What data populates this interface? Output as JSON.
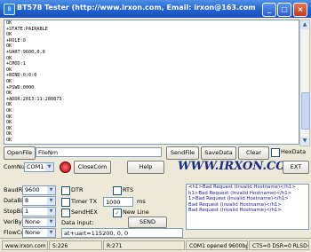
{
  "window": {
    "title": "BT578 Tester (http://www.irxon.com, Email: irxon@163.com) V1.0"
  },
  "output": {
    "lines": [
      "OK",
      "+STATE:PAIRABLE",
      "OK",
      "+ROLE:0",
      "OK",
      "+UART:9600,0,0",
      "OK",
      "+CMOD:1",
      "OK",
      "+BIND:0:0:0",
      "OK",
      "+PSWD:0000",
      "OK",
      "+ADDR:2013:11:280873",
      "OK",
      "OK",
      "OK",
      "OK",
      "OK",
      "OK",
      "OK"
    ]
  },
  "file_row": {
    "open_file": "OpenFile",
    "file_name": "FileNm",
    "send_file": "SendFile",
    "save_data": "SaveData",
    "clear": "Clear",
    "hex_data": "HexData"
  },
  "com_row": {
    "com_num_label": "ComNum",
    "com_port": "COM1",
    "close_com": "CloseCom",
    "help": "Help",
    "logo": "WWW.IRXON.COM",
    "exit": "EXT"
  },
  "settings": {
    "baud_label": "BaudRa",
    "baud_value": "9600",
    "databits_label": "DataBi",
    "databits_value": "8",
    "stopbits_label": "StopBi",
    "stopbits_value": "1",
    "verify_label": "VeriBy",
    "verify_value": "None",
    "flow_label": "FlowCo",
    "flow_value": "None",
    "dtr": "DTR",
    "rts": "RTS",
    "timer": "Timer TX",
    "timer_value": "1000",
    "timer_unit": "ms",
    "send_hex": "SendHEX",
    "new_line": "New Line",
    "new_line_checked": "✓",
    "data_input_label": "Data input:",
    "send": "SEND",
    "data_input_value": "at+uart=115200, 0, 0"
  },
  "received": {
    "lines": [
      "<h1>Bad Request (Invalid Hostname)</h1>",
      "h1>Bad Request (Invalid Hostname)</h1>",
      "1>Bad Request (Invalid Hostname)</h1>",
      "Bad Request (Invalid Hostname)</h1>",
      "Bad Request (Invalid Hostname)</h1>"
    ]
  },
  "status": {
    "site": "www.irxon.com",
    "sent": "S:226",
    "received": "R:271",
    "port": "COM1 opened 9600bps 8 1",
    "signals": "CTS=0 DSR=0 RLSD=0"
  }
}
